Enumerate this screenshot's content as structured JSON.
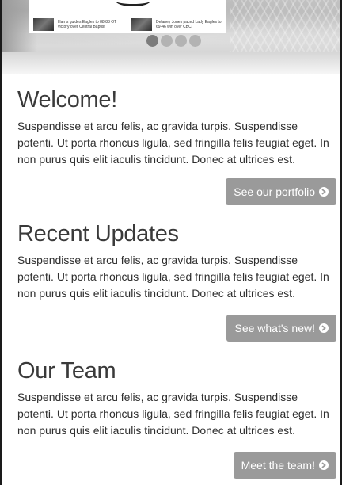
{
  "slider": {
    "news": [
      {
        "headline": "Harris guides Eagles to 88-83 OT victory over Central Baptist"
      },
      {
        "headline": "Delaney Jones paced Lady Eagles to 69-46 win over CBC"
      }
    ],
    "dots": 4,
    "active_dot": 0
  },
  "sections": [
    {
      "title": "Welcome!",
      "body": "Suspendisse et arcu felis, ac gravida turpis. Suspendisse potenti. Ut porta rhoncus ligula, sed fringilla felis feugiat eget. In non purus quis elit iaculis tincidunt. Donec at ultrices est.",
      "button_label": "See our portfolio",
      "button_icon": "circle-arrow-right-icon"
    },
    {
      "title": "Recent Updates",
      "body": "Suspendisse et arcu felis, ac gravida turpis. Suspendisse potenti. Ut porta rhoncus ligula, sed fringilla felis feugiat eget. In non purus quis elit iaculis tincidunt. Donec at ultrices est.",
      "button_label": "See what's new!",
      "button_icon": "circle-arrow-right-icon"
    },
    {
      "title": "Our Team",
      "body": "Suspendisse et arcu felis, ac gravida turpis. Suspendisse potenti. Ut porta rhoncus ligula, sed fringilla felis feugiat eget. In non purus quis elit iaculis tincidunt. Donec at ultrices est.",
      "button_label": "Meet the team!",
      "button_icon": "circle-arrow-right-icon"
    }
  ],
  "colors": {
    "button_bg": "#9a9a9a",
    "button_text": "#ffffff",
    "heading": "#3a3a3a",
    "dot_active": "#7c7c7c",
    "dot_inactive": "#b3b3b3"
  }
}
